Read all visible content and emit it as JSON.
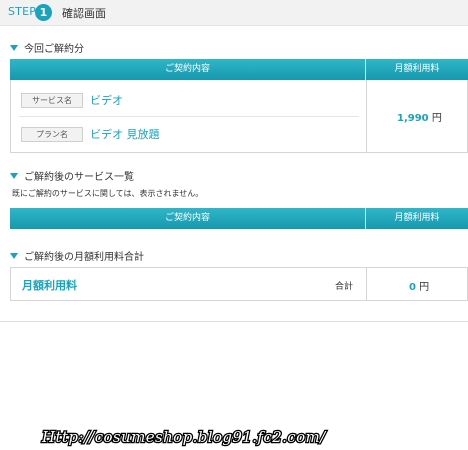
{
  "step": {
    "label": "STEP",
    "number": "1",
    "title": "確認画面"
  },
  "section_current": {
    "heading": "今回ご解約分",
    "header_left": "ご契約内容",
    "header_right": "月額利用料",
    "rows": [
      {
        "tag": "サービス名",
        "value": "ビデオ"
      },
      {
        "tag": "プラン名",
        "value": "ビデオ 見放題"
      }
    ],
    "price": "1,990",
    "currency": "円"
  },
  "section_after": {
    "heading": "ご解約後のサービス一覧",
    "note": "既にご解約のサービスに関しては、表示されません。",
    "header_left": "ご契約内容",
    "header_right": "月額利用料"
  },
  "section_total": {
    "heading": "ご解約後の月額利用料合計",
    "label": "月額利用料",
    "total_label": "合計",
    "amount": "0",
    "currency": "円"
  },
  "watermark": "Http://cosumeshop.blog91.fc2.com/",
  "colors": {
    "accent": "#1aa3bd",
    "header_bg": "#1f9fb6",
    "page_bg": "#ffffff"
  }
}
